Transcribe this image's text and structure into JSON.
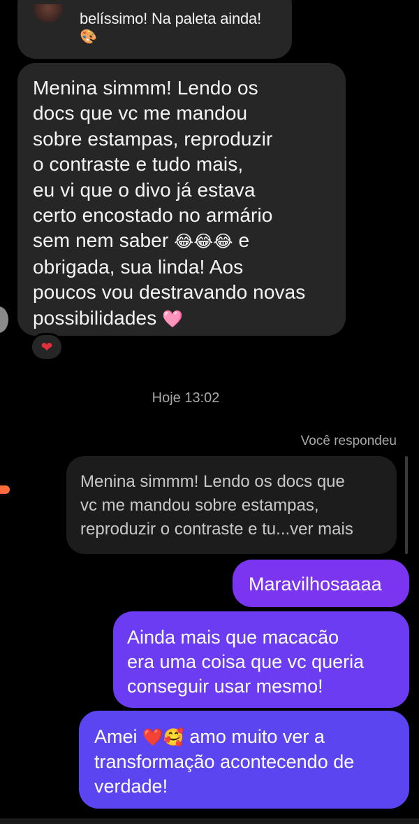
{
  "conversation": {
    "top_message": {
      "line1": "belíssimo! Na paleta ainda!",
      "emoji": "🎨"
    },
    "received_message": {
      "lines": [
        "Menina simmm! Lendo os",
        "docs que vc me mandou",
        "sobre estampas, reproduzir",
        "o contraste e tudo mais,",
        "eu vi que o divo já estava",
        "certo encostado no armário"
      ],
      "line7_text": "sem nem saber",
      "line7_emojis": "😂😂😂",
      "line7_tail": "e",
      "line8": "obrigada, sua linda! Aos",
      "line9": "poucos vou destravando novas",
      "line10_text": "possibilidades",
      "line10_emoji": "🩷"
    },
    "reaction_icon": "❤",
    "timestamp": "Hoje 13:02",
    "reply_label": "Você respondeu",
    "quoted_reply": {
      "lines": [
        "Menina simmm! Lendo os docs que",
        "vc me mandou sobre estampas,",
        "reproduzir o contraste e tu...ver mais"
      ]
    },
    "sent_messages": {
      "msg1": "Maravilhosaaaa",
      "msg2_lines": [
        "Ainda mais que macacão",
        "era uma coisa que vc queria",
        "conseguir usar mesmo!"
      ],
      "msg3_line1_text": "Amei",
      "msg3_line1_emojis": "❤️🥰",
      "msg3_line1_tail": "amo muito ver a",
      "msg3_line2": "transformação acontecendo de",
      "msg3_line3": "verdade!"
    }
  },
  "colors": {
    "background": "#000000",
    "received_bubble": "#262626",
    "quote_bubble": "#1c1c1c",
    "sent_bubble_1": "#7b35f0",
    "sent_bubble_2": "#6b3cf2",
    "sent_bubble_3": "#5a45f0",
    "muted_text": "#a8a8a8"
  }
}
